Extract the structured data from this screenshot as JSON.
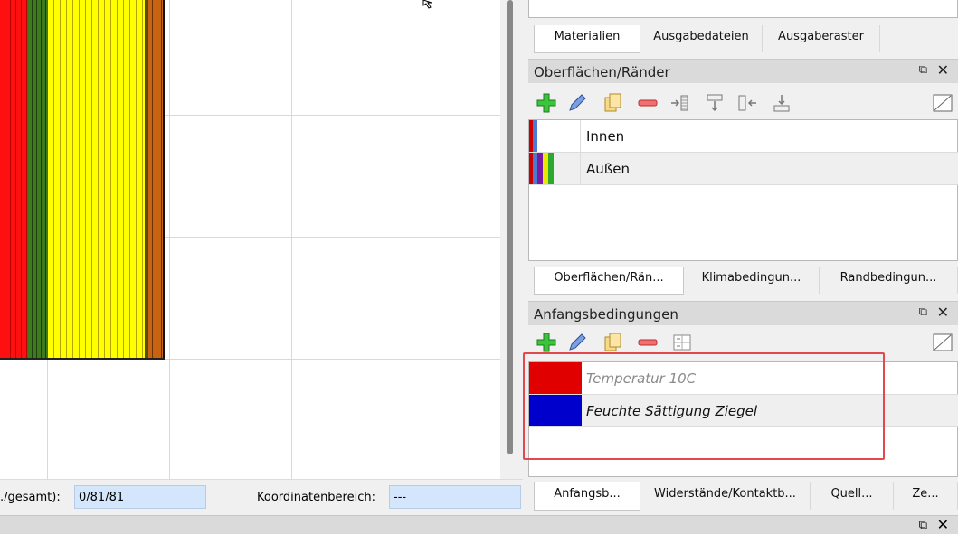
{
  "top_tabs": [
    "Materialien",
    "Ausgabedateien",
    "Ausgaberaster"
  ],
  "surfaces_dock": {
    "title": "Oberflächen/Ränder",
    "float_glyph": "⧉",
    "close_glyph": "✕",
    "items": [
      {
        "label": "Innen",
        "colors": [
          "#cc0000",
          "#4a7bd0"
        ]
      },
      {
        "label": "Außen",
        "colors": [
          "#cc0000",
          "#4a7bd0",
          "#7a1aa0",
          "#e8e800",
          "#2ea82e"
        ]
      }
    ],
    "tabs": [
      "Oberflächen/Rän...",
      "Klimabedingun...",
      "Randbedingun..."
    ]
  },
  "initial_dock": {
    "title": "Anfangsbedingungen",
    "float_glyph": "⧉",
    "close_glyph": "✕",
    "items": [
      {
        "label": "Temperatur 10C",
        "color": "#e00000"
      },
      {
        "label": "Feuchte Sättigung Ziegel",
        "color": "#0000cc"
      }
    ],
    "tabs": [
      "Anfangsb...",
      "Widerstände/Kontaktb...",
      "Quell...",
      "Ze..."
    ]
  },
  "status": {
    "count_label": "./gesamt):",
    "count_value": "0/81/81",
    "coord_label": "Koordinatenbereich:",
    "coord_value": "---"
  },
  "bottom": {
    "float_glyph": "⧉",
    "close_glyph": "✕"
  },
  "icons": [
    "add-icon",
    "edit-icon",
    "copy-icon",
    "remove-icon",
    "assign-icon",
    "table-icon"
  ],
  "colors": {
    "highlight": "#e0494f",
    "tab_active": "#ffffff",
    "dock_title": "#dadada"
  }
}
